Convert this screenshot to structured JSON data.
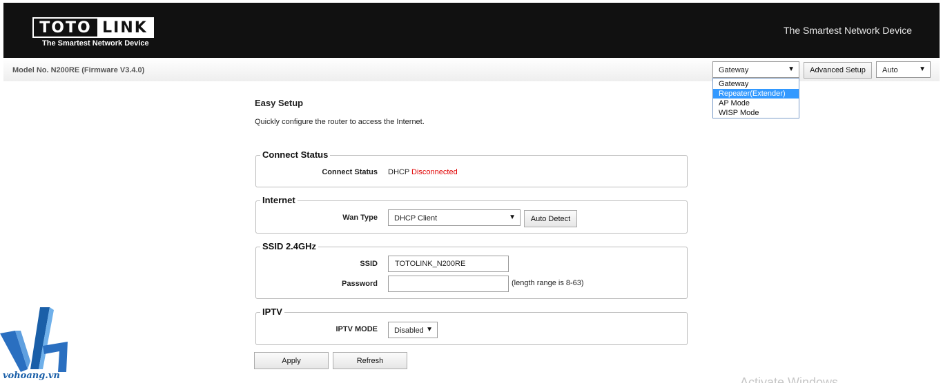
{
  "header": {
    "logo_left": "TOTO",
    "logo_right": "LINK",
    "logo_tagline": "The Smartest Network Device",
    "tagline": "The Smartest Network Device"
  },
  "modelbar": {
    "model_text": "Model No. N200RE (Firmware V3.4.0)",
    "mode_select_value": "Gateway",
    "mode_options": [
      "Gateway",
      "Repeater(Extender)",
      "AP Mode",
      "WISP Mode"
    ],
    "highlighted_option": "Repeater(Extender)",
    "advanced_button": "Advanced Setup",
    "language_value": "Auto"
  },
  "main": {
    "title": "Easy Setup",
    "description": "Quickly configure the router to access the Internet.",
    "connect_status": {
      "legend": "Connect Status",
      "label": "Connect Status",
      "value_prefix": "DHCP",
      "value_state": "Disconnected"
    },
    "internet": {
      "legend": "Internet",
      "wan_label": "Wan Type",
      "wan_value": "DHCP Client",
      "auto_detect_button": "Auto Detect"
    },
    "ssid": {
      "legend": "SSID 2.4GHz",
      "ssid_label": "SSID",
      "ssid_value": "TOTOLINK_N200RE",
      "password_label": "Password",
      "password_value": "",
      "password_hint": "(length range is 8-63)"
    },
    "iptv": {
      "legend": "IPTV",
      "mode_label": "IPTV MODE",
      "mode_value": "Disabled"
    },
    "apply_button": "Apply",
    "refresh_button": "Refresh"
  },
  "watermark": {
    "site": "vohoang.vn",
    "os_notice": "Activate Windows"
  },
  "colors": {
    "header_bg": "#111111",
    "status_error": "#e00000",
    "dropdown_highlight": "#3399ff",
    "watermark_blue": "#1a5fa8"
  },
  "icons": {
    "select_arrow": "triangle-down-icon"
  }
}
